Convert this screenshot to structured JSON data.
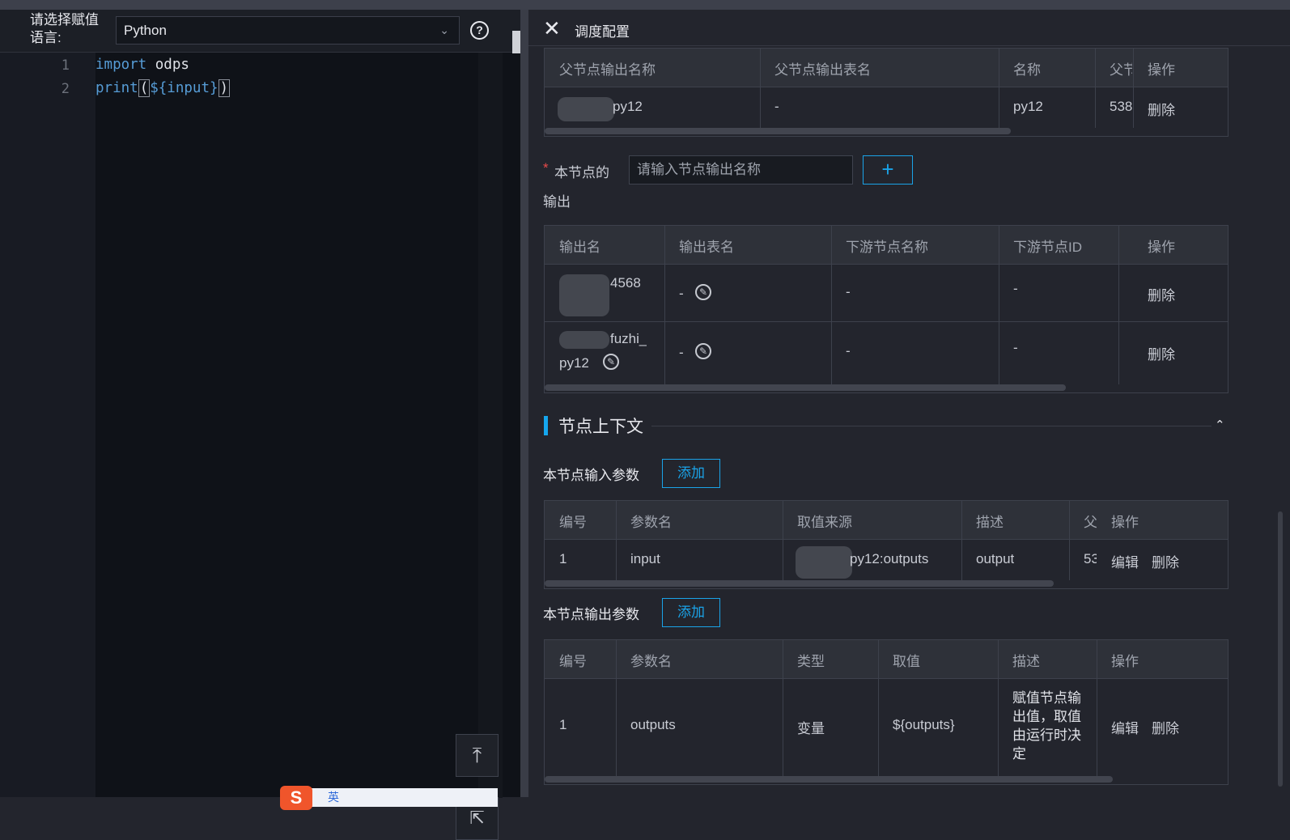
{
  "left": {
    "lang_label": "请选择赋值语言:",
    "lang_value": "Python",
    "code_lines": [
      {
        "num": "1",
        "kw": "import",
        "rest": " odps"
      },
      {
        "num": "2",
        "kw": "print",
        "rest_pre": "(",
        "rest_mid": "${input}",
        "rest_post": ")"
      }
    ]
  },
  "panel": {
    "title": "调度配置"
  },
  "parent_table": {
    "headers": [
      "父节点输出名称",
      "父节点输出表名",
      "名称",
      "父节",
      "操作"
    ],
    "row": {
      "out_name": "py12",
      "table_name": "-",
      "name": "py12",
      "id": "538",
      "action": "删除"
    }
  },
  "node_output": {
    "label_a": "本节点的",
    "label_b": "输出",
    "placeholder": "请输入节点输出名称",
    "add_icon": "+"
  },
  "output_table": {
    "headers": [
      "输出名",
      "输出表名",
      "下游节点名称",
      "下游节点ID",
      "操作"
    ],
    "rows": [
      {
        "name": "4568",
        "table": "-",
        "downstream": "-",
        "downstream_id": "-",
        "action": "删除"
      },
      {
        "name": "fuzhi_",
        "name2": "py12",
        "table": "-",
        "downstream": "-",
        "downstream_id": "-",
        "action": "删除"
      }
    ]
  },
  "context": {
    "title": "节点上下文",
    "input_label": "本节点输入参数",
    "output_label": "本节点输出参数",
    "add_label": "添加"
  },
  "input_params": {
    "headers": [
      "编号",
      "参数名",
      "取值来源",
      "描述",
      "父",
      "操作"
    ],
    "row": {
      "no": "1",
      "name": "input",
      "source": "py12:outputs",
      "desc": "output",
      "id": "53",
      "edit": "编辑",
      "delete": "删除"
    }
  },
  "output_params": {
    "headers": [
      "编号",
      "参数名",
      "类型",
      "取值",
      "描述",
      "操作"
    ],
    "row": {
      "no": "1",
      "name": "outputs",
      "type": "变量",
      "value": "${outputs}",
      "desc": "赋值节点输出值，取值由运行时决定",
      "edit": "编辑",
      "delete": "删除"
    }
  },
  "ime": {
    "text": "英"
  },
  "colors": {
    "accent": "#18a5ee",
    "required": "#e84a4a",
    "keyword": "#569cd6"
  }
}
